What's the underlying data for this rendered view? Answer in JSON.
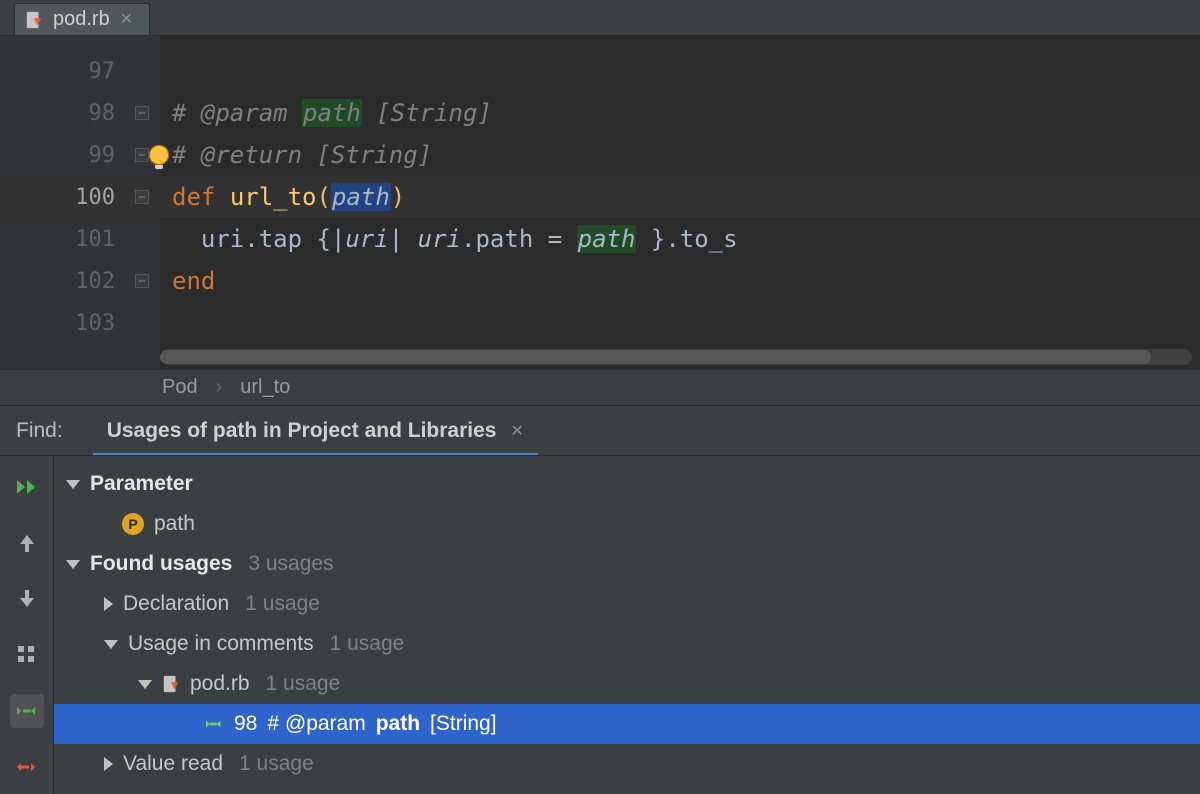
{
  "tab": {
    "filename": "pod.rb"
  },
  "editor": {
    "lines": [
      {
        "num": "97"
      },
      {
        "num": "98"
      },
      {
        "num": "99"
      },
      {
        "num": "100"
      },
      {
        "num": "101"
      },
      {
        "num": "102"
      },
      {
        "num": "103"
      }
    ],
    "comment_param": " @param ",
    "comment_param_name": "path",
    "comment_param_tail": " [String]",
    "comment_return": " @return [String]",
    "kw_def": "def",
    "fn_name": "url_to",
    "param_name": "path",
    "body_prefix": "uri.tap {|",
    "body_uri": "uri",
    "body_mid": "| ",
    "body_uri2": "uri",
    "body_dotpath": ".path = ",
    "body_path2": "path",
    "body_tail": " }.to_s",
    "kw_end": "end"
  },
  "breadcrumb": {
    "a": "Pod",
    "b": "url_to"
  },
  "find": {
    "label": "Find:",
    "tab_title": "Usages of path in Project and Libraries",
    "param_header": "Parameter",
    "param_name": "path",
    "found_header": "Found usages",
    "found_count": "3 usages",
    "declaration": "Declaration",
    "declaration_count": "1 usage",
    "comments": "Usage in comments",
    "comments_count": "1 usage",
    "file_name": "pod.rb",
    "file_count": "1 usage",
    "sel_line_no": "98",
    "sel_prefix": "# @param ",
    "sel_word": "path",
    "sel_suffix": " [String]",
    "value_read": "Value read",
    "value_read_count": "1 usage"
  }
}
